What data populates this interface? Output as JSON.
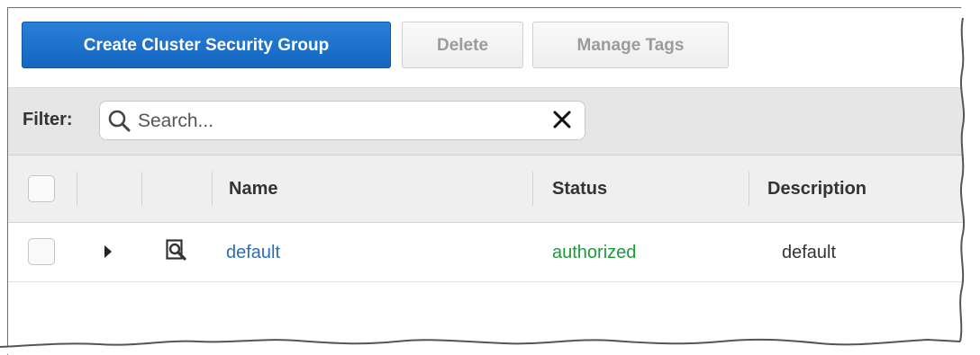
{
  "toolbar": {
    "create_label": "Create Cluster Security Group",
    "delete_label": "Delete",
    "manage_tags_label": "Manage Tags"
  },
  "filter": {
    "label": "Filter:",
    "placeholder": "Search...",
    "value": ""
  },
  "table": {
    "columns": [
      "Name",
      "Status",
      "Description"
    ],
    "rows": [
      {
        "name": "default",
        "status": "authorized",
        "description": "default"
      }
    ]
  },
  "colors": {
    "primary_button": "#1c72cc",
    "link": "#2a6ebb",
    "status_ok": "#1f9a3a"
  },
  "icons": [
    "search-icon",
    "clear-icon",
    "expand-caret-icon",
    "detail-icon"
  ]
}
